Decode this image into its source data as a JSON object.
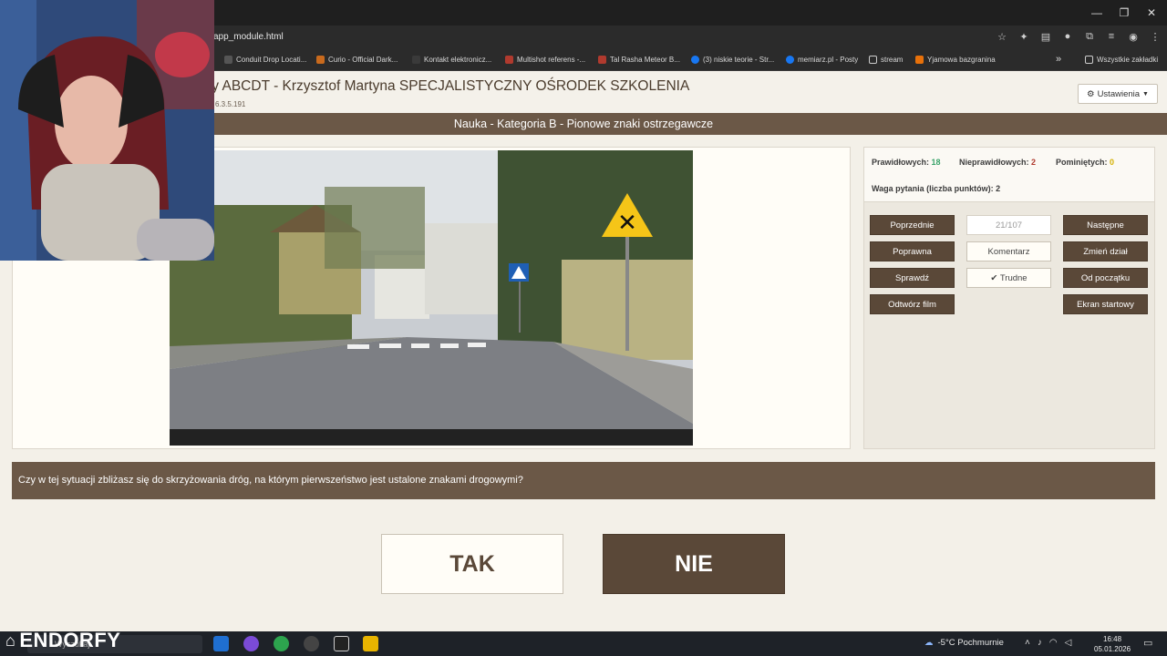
{
  "browser": {
    "url": "app_module.html",
    "window_controls": [
      "—",
      "❐",
      "✕"
    ],
    "bookmarks": [
      {
        "label": "Conduit Drop Locati..."
      },
      {
        "label": "Curio - Official Dark..."
      },
      {
        "label": "Kontakt elektronicz..."
      },
      {
        "label": "Multishot referens -..."
      },
      {
        "label": "Tal Rasha Meteor B..."
      },
      {
        "label": "(3) niskie teorie - Str..."
      },
      {
        "label": "memiarz.pl - Posty"
      },
      {
        "label": "stream"
      },
      {
        "label": "Yjamowa bazgranina"
      }
    ],
    "all_bookmarks": "Wszystkie zakładki",
    "more_bookmarks": "»"
  },
  "app": {
    "title": "ty ABCDT - Krzysztof Martyna SPECJALISTYCZNY OŚRODEK SZKOLENIA",
    "version": "6.3.5.191",
    "settings_label": "Ustawienia",
    "subject": "Nauka - Kategoria B - Pionowe znaki ostrzegawcze"
  },
  "stats": {
    "correct_label": "Prawidłowych:",
    "correct_value": "18",
    "incorrect_label": "Nieprawidłowych:",
    "incorrect_value": "2",
    "skipped_label": "Pominiętych:",
    "skipped_value": "0",
    "weight_text": "Waga pytania (liczba punktów): 2"
  },
  "controls": {
    "previous": "Poprzednie",
    "counter": "21/107",
    "next": "Następne",
    "correct_answer": "Poprawna",
    "comment": "Komentarz",
    "change_section": "Zmień dział",
    "check": "Sprawdź",
    "difficult": "✔ Trudne",
    "from_start": "Od początku",
    "play_video": "Odtwórz film",
    "start_screen": "Ekran startowy"
  },
  "question": {
    "text": "Czy w tej sytuacji zbliżasz się do skrzyżowania dróg, na którym pierwszeństwo jest ustalone znakami drogowymi?",
    "yes": "TAK",
    "no": "NIE"
  },
  "taskbar": {
    "search_placeholder": "Wyszukaj",
    "weather": "-5°C Pochmurnie",
    "time": "16:48",
    "date": "05.01.2026",
    "brand": "ENDORFY"
  },
  "colors": {
    "accent_brown": "#6b5847",
    "button_brown": "#5a4838",
    "correct_green": "#3aa36a",
    "incorrect_red": "#b03a2e",
    "skipped_yellow": "#d4b000"
  }
}
